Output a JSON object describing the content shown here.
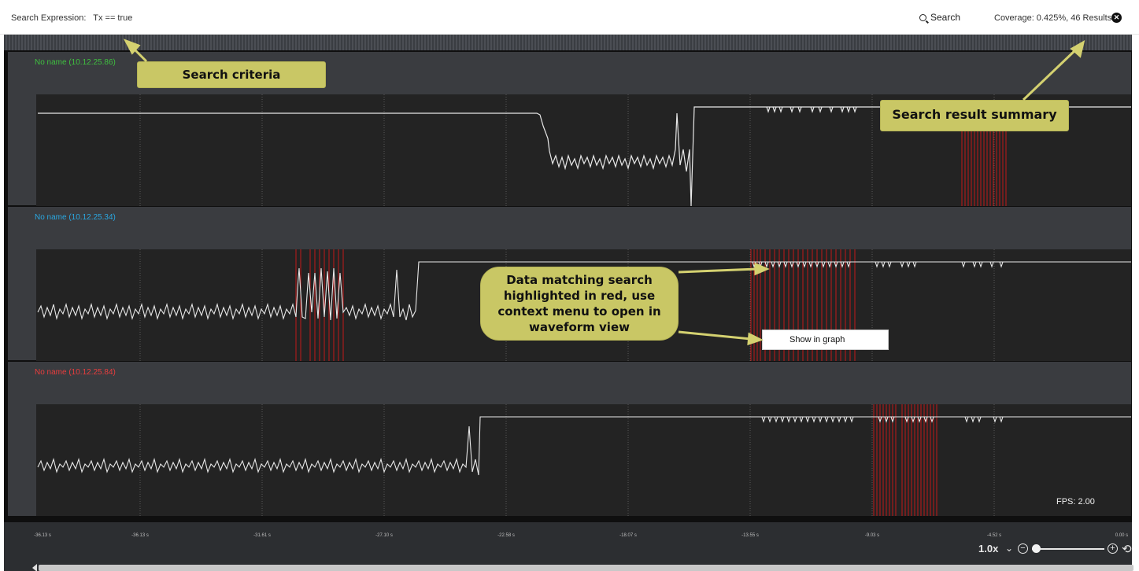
{
  "search": {
    "expression_label": "Search Expression:",
    "expression_value": "Tx == true",
    "search_button": "Search",
    "coverage": "Coverage: 0.425%, 46 Results",
    "clear_icon": "close-circle-icon"
  },
  "channels": [
    {
      "name": "No name (10.12.25.86)",
      "color": "#3fbf3f"
    },
    {
      "name": "No name (10.12.25.34)",
      "color": "#2aa7e0"
    },
    {
      "name": "No name (10.12.25.84)",
      "color": "#e83d3d"
    }
  ],
  "time_axis": {
    "ticks": [
      "-36.13 s",
      "-36.13 s",
      "-31.61 s",
      "-27.10 s",
      "-22.58 s",
      "-18.07 s",
      "-13.55 s",
      "-9.03 s",
      "-4.52 s",
      "0.00 s"
    ]
  },
  "zoom": {
    "level": "1.0x",
    "slider_fraction": 0
  },
  "fps": "FPS: 2.00",
  "context_menu": {
    "item": "Show in graph"
  },
  "annotations": {
    "search_criteria": "Search criteria",
    "search_result_summary": "Search result summary",
    "highlight_line1": "Data matching search",
    "highlight_line2": "highlighted in red, use",
    "highlight_line3": "context menu to open in",
    "highlight_line4": "waveform view"
  },
  "colors": {
    "highlight": "#d42020",
    "signal": "#e8e8e8",
    "callout": "#c9c765"
  }
}
